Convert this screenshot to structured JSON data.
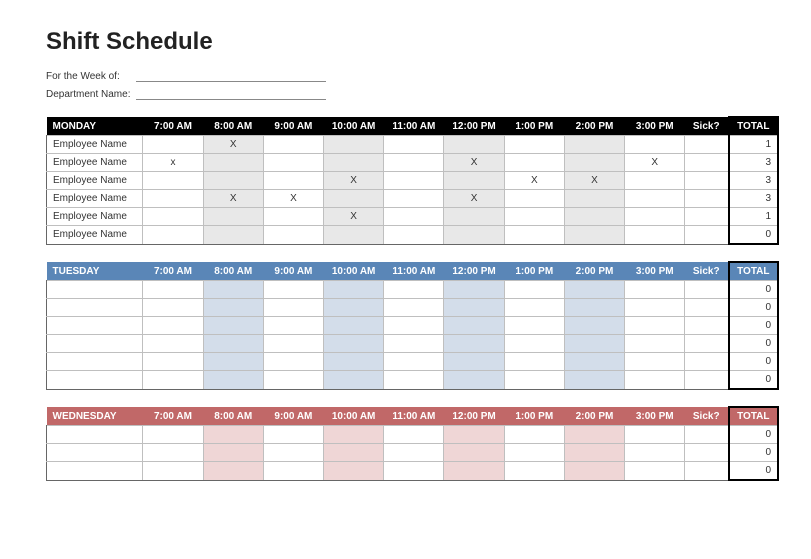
{
  "title": "Shift Schedule",
  "meta": {
    "week_label": "For the Week of:",
    "week_value": "",
    "dept_label": "Department Name:",
    "dept_value": ""
  },
  "time_headers": [
    "7:00 AM",
    "8:00 AM",
    "9:00 AM",
    "10:00 AM",
    "11:00 AM",
    "12:00 PM",
    "1:00 PM",
    "2:00 PM",
    "3:00 PM"
  ],
  "sick_header": "Sick?",
  "total_header": "TOTAL",
  "shaded_hour_indices": [
    1,
    3,
    5,
    7
  ],
  "days": [
    {
      "name": "MONDAY",
      "header_class": "hdr-black",
      "shade_class": "shade-gray",
      "rows": [
        {
          "name": "Employee Name",
          "marks": [
            "",
            "X",
            "",
            "",
            "",
            "",
            "",
            "",
            ""
          ],
          "sick": "",
          "total": "1"
        },
        {
          "name": "Employee Name",
          "marks": [
            "x",
            "",
            "",
            "",
            "",
            "X",
            "",
            "",
            "X"
          ],
          "sick": "",
          "total": "3"
        },
        {
          "name": "Employee Name",
          "marks": [
            "",
            "",
            "",
            "X",
            "",
            "",
            "X",
            "X",
            ""
          ],
          "sick": "",
          "total": "3"
        },
        {
          "name": "Employee Name",
          "marks": [
            "",
            "X",
            "X",
            "",
            "",
            "X",
            "",
            "",
            ""
          ],
          "sick": "",
          "total": "3"
        },
        {
          "name": "Employee Name",
          "marks": [
            "",
            "",
            "",
            "X",
            "",
            "",
            "",
            "",
            ""
          ],
          "sick": "",
          "total": "1"
        },
        {
          "name": "Employee Name",
          "marks": [
            "",
            "",
            "",
            "",
            "",
            "",
            "",
            "",
            ""
          ],
          "sick": "",
          "total": "0"
        }
      ]
    },
    {
      "name": "TUESDAY",
      "header_class": "hdr-blue",
      "shade_class": "shade-blue",
      "rows": [
        {
          "name": "",
          "marks": [
            "",
            "",
            "",
            "",
            "",
            "",
            "",
            "",
            ""
          ],
          "sick": "",
          "total": "0"
        },
        {
          "name": "",
          "marks": [
            "",
            "",
            "",
            "",
            "",
            "",
            "",
            "",
            ""
          ],
          "sick": "",
          "total": "0"
        },
        {
          "name": "",
          "marks": [
            "",
            "",
            "",
            "",
            "",
            "",
            "",
            "",
            ""
          ],
          "sick": "",
          "total": "0"
        },
        {
          "name": "",
          "marks": [
            "",
            "",
            "",
            "",
            "",
            "",
            "",
            "",
            ""
          ],
          "sick": "",
          "total": "0"
        },
        {
          "name": "",
          "marks": [
            "",
            "",
            "",
            "",
            "",
            "",
            "",
            "",
            ""
          ],
          "sick": "",
          "total": "0"
        },
        {
          "name": "",
          "marks": [
            "",
            "",
            "",
            "",
            "",
            "",
            "",
            "",
            ""
          ],
          "sick": "",
          "total": "0"
        }
      ]
    },
    {
      "name": "WEDNESDAY",
      "header_class": "hdr-red",
      "shade_class": "shade-red",
      "rows": [
        {
          "name": "",
          "marks": [
            "",
            "",
            "",
            "",
            "",
            "",
            "",
            "",
            ""
          ],
          "sick": "",
          "total": "0"
        },
        {
          "name": "",
          "marks": [
            "",
            "",
            "",
            "",
            "",
            "",
            "",
            "",
            ""
          ],
          "sick": "",
          "total": "0"
        },
        {
          "name": "",
          "marks": [
            "",
            "",
            "",
            "",
            "",
            "",
            "",
            "",
            ""
          ],
          "sick": "",
          "total": "0"
        }
      ]
    }
  ]
}
